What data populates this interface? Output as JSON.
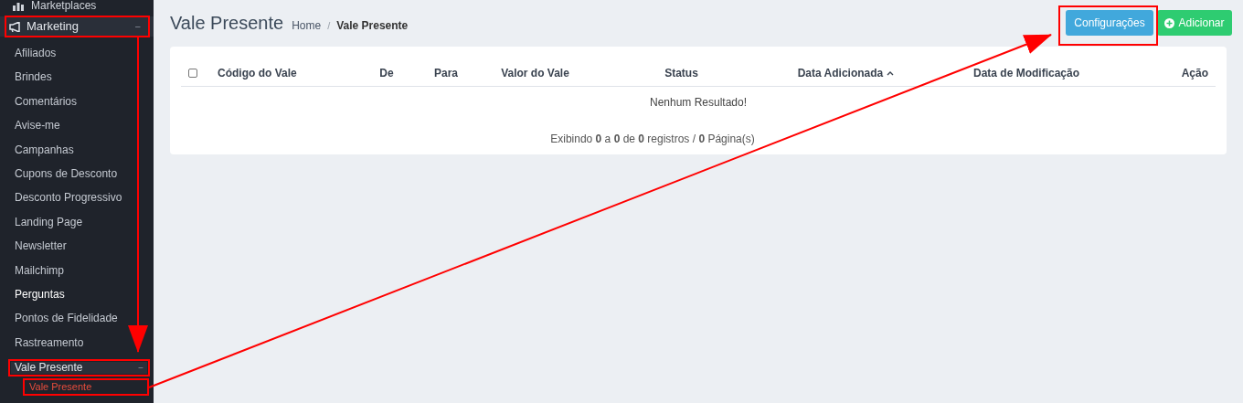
{
  "sidebar": {
    "items": [
      {
        "label": "Marketplaces"
      },
      {
        "label": "Marketing",
        "expanded": true,
        "toggle": "−",
        "children": [
          {
            "label": "Afiliados",
            "highlighted": false
          },
          {
            "label": "Brindes",
            "highlighted": false
          },
          {
            "label": "Comentários",
            "highlighted": false
          },
          {
            "label": "Avise-me",
            "highlighted": false
          },
          {
            "label": "Campanhas",
            "highlighted": false
          },
          {
            "label": "Cupons de Desconto",
            "highlighted": false
          },
          {
            "label": "Desconto Progressivo",
            "highlighted": false
          },
          {
            "label": "Landing Page",
            "highlighted": false
          },
          {
            "label": "Newsletter",
            "highlighted": false
          },
          {
            "label": "Mailchimp",
            "highlighted": false
          },
          {
            "label": "Perguntas",
            "highlighted": true
          },
          {
            "label": "Pontos de Fidelidade",
            "highlighted": false
          },
          {
            "label": "Rastreamento",
            "highlighted": false
          },
          {
            "label": "Vale Presente",
            "highlighted": false,
            "expanded": true,
            "toggle": "−",
            "children": [
              {
                "label": "Vale Presente",
                "selected": true
              }
            ]
          }
        ]
      }
    ]
  },
  "header": {
    "title": "Vale Presente",
    "breadcrumb": [
      "Home",
      "Vale Presente"
    ],
    "separator": "/",
    "buttons": [
      {
        "label": "Configurações",
        "kind": "info"
      },
      {
        "label": "Adicionar",
        "kind": "success"
      }
    ]
  },
  "table": {
    "select_all": {
      "checked": false
    },
    "columns": [
      {
        "label": "Código do Vale",
        "sorted": false
      },
      {
        "label": "De",
        "sorted": false
      },
      {
        "label": "Para",
        "sorted": false
      },
      {
        "label": "Valor do Vale",
        "sorted": false
      },
      {
        "label": "Status",
        "sorted": false
      },
      {
        "label": "Data Adicionada",
        "sorted": true
      },
      {
        "label": "Data de Modificação",
        "sorted": false
      },
      {
        "label": "Ação",
        "sorted": false
      }
    ],
    "empty_message": "Nenhum Resultado!",
    "pagination": "Exibindo **0** a **0** de **0** registros / **0** Página(s)"
  }
}
